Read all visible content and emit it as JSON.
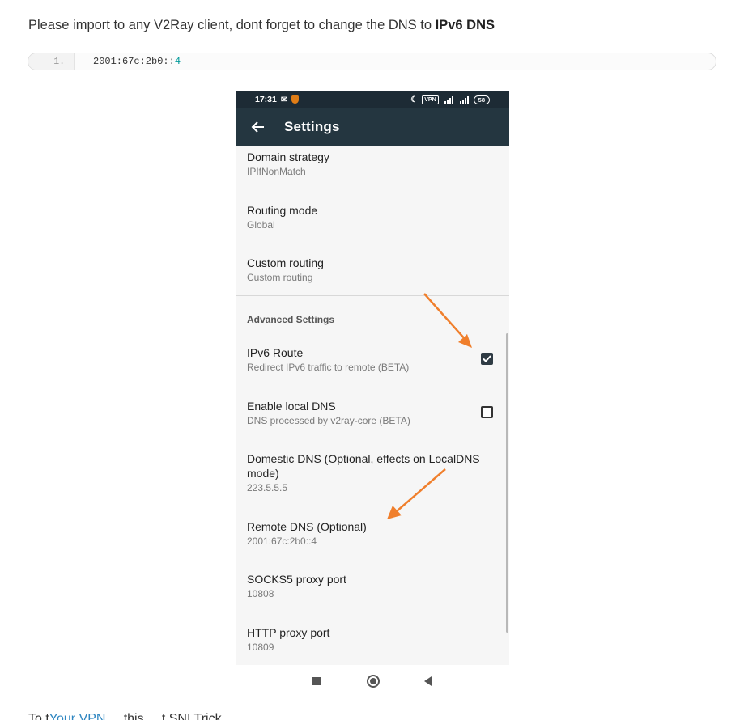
{
  "intro": {
    "text": "Please import to any V2Ray client, dont forget to change the DNS to ",
    "bold": "IPv6 DNS"
  },
  "code": {
    "line_number": "1.",
    "address_prefix": "2001:67c:2b0::",
    "address_suffix": "4"
  },
  "phone": {
    "status": {
      "time": "17:31",
      "vpn_label": "VPN",
      "battery": "58"
    },
    "appbar": {
      "title": "Settings"
    },
    "prefs": [
      {
        "title": "Domain strategy",
        "subtitle": "IPIfNonMatch"
      },
      {
        "title": "Routing mode",
        "subtitle": "Global"
      },
      {
        "title": "Custom routing",
        "subtitle": "Custom routing"
      }
    ],
    "category": "Advanced Settings",
    "advanced": [
      {
        "title": "IPv6 Route",
        "subtitle": "Redirect IPv6 traffic to remote (BETA)",
        "checked": true
      },
      {
        "title": "Enable local DNS",
        "subtitle": "DNS processed by v2ray-core (BETA)",
        "checked": false
      },
      {
        "title": "Domestic DNS (Optional, effects on LocalDNS mode)",
        "subtitle": "223.5.5.5"
      },
      {
        "title": "Remote DNS (Optional)",
        "subtitle": "2001:67c:2b0::4"
      },
      {
        "title": "SOCKS5 proxy port",
        "subtitle": "10808"
      },
      {
        "title": "HTTP proxy port",
        "subtitle": "10809"
      }
    ]
  },
  "tail": {
    "before": "To t",
    "link": "Your VPN",
    "after": " ... this ... t SNI Trick"
  },
  "colors": {
    "appbar": "#243640",
    "statusbar": "#1d2b35",
    "arrow": "#f07f2c",
    "checkbox_checked": "#2f3b44"
  }
}
